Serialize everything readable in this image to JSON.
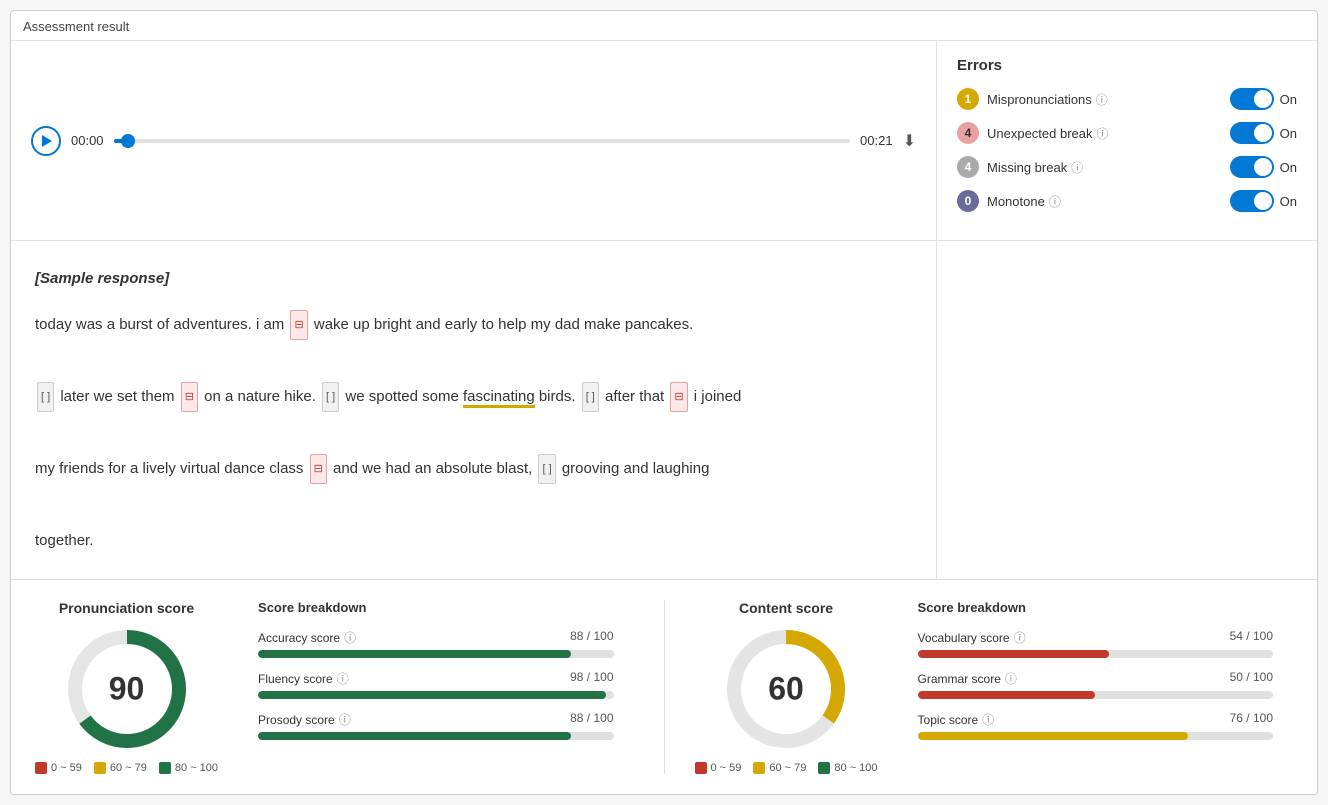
{
  "pageTitle": "Assessment result",
  "audio": {
    "timeStart": "00:00",
    "timeEnd": "00:21",
    "progressPercent": 2
  },
  "errors": {
    "title": "Errors",
    "items": [
      {
        "id": "mispronunciations",
        "count": "1",
        "label": "Mispronunciations",
        "badgeClass": "badge-yellow",
        "toggleOn": true
      },
      {
        "id": "unexpected-break",
        "count": "4",
        "label": "Unexpected break",
        "badgeClass": "badge-pink",
        "toggleOn": true
      },
      {
        "id": "missing-break",
        "count": "4",
        "label": "Missing break",
        "badgeClass": "badge-gray",
        "toggleOn": true
      },
      {
        "id": "monotone",
        "count": "0",
        "label": "Monotone",
        "badgeClass": "badge-purple",
        "toggleOn": true
      }
    ],
    "toggleLabel": "On"
  },
  "transcript": {
    "sampleLabel": "[Sample response]",
    "text": "today was a burst of adventures. i am wake up bright and early to help my dad make pancakes. later we set them on a nature hike. we spotted some fascinating birds. after that i joined my friends for a lively virtual dance class and we had an absolute blast, grooving and laughing together."
  },
  "pronunciation": {
    "title": "Pronunciation score",
    "score": "90",
    "breakdown": {
      "title": "Score breakdown",
      "items": [
        {
          "label": "Accuracy score",
          "value": "88 / 100",
          "percent": 88,
          "colorClass": "fill-green"
        },
        {
          "label": "Fluency score",
          "value": "98 / 100",
          "percent": 98,
          "colorClass": "fill-green"
        },
        {
          "label": "Prosody score",
          "value": "88 / 100",
          "percent": 88,
          "colorClass": "fill-green"
        }
      ]
    },
    "legend": [
      {
        "label": "0 ~ 59",
        "colorClass": "dot-red"
      },
      {
        "label": "60 ~ 79",
        "colorClass": "dot-yellow"
      },
      {
        "label": "80 ~ 100",
        "colorClass": "dot-green"
      }
    ]
  },
  "content": {
    "title": "Content score",
    "score": "60",
    "breakdown": {
      "title": "Score breakdown",
      "items": [
        {
          "label": "Vocabulary score",
          "value": "54 / 100",
          "percent": 54,
          "colorClass": "fill-red"
        },
        {
          "label": "Grammar score",
          "value": "50 / 100",
          "percent": 50,
          "colorClass": "fill-red"
        },
        {
          "label": "Topic score",
          "value": "76 / 100",
          "percent": 76,
          "colorClass": "fill-yellow"
        }
      ]
    },
    "legend": [
      {
        "label": "0 ~ 59",
        "colorClass": "dot-red"
      },
      {
        "label": "60 ~ 79",
        "colorClass": "dot-yellow"
      },
      {
        "label": "80 ~ 100",
        "colorClass": "dot-green"
      }
    ]
  }
}
